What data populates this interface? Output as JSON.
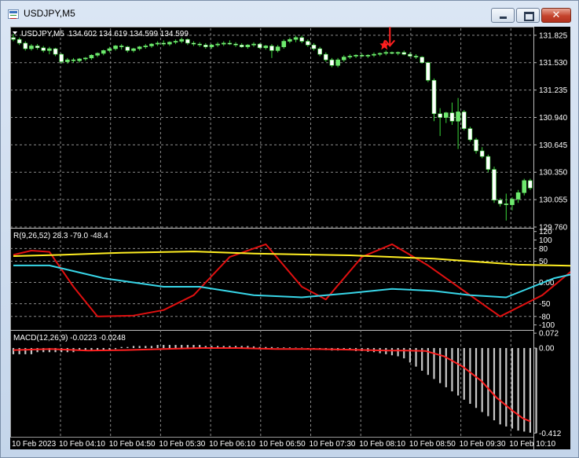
{
  "window": {
    "title": "USDJPY,M5",
    "buttons": {
      "minimize": "minimize",
      "maximize": "maximize",
      "close": "✕"
    }
  },
  "colors": {
    "background": "#000000",
    "grid": "#8a8a8a",
    "text": "#ffffff",
    "candle_up": "#6ee96e",
    "candle_down": "#ffffff",
    "wick": "#39d639",
    "annotation": "#ff1f1f",
    "line_red": "#e01010",
    "line_yellow": "#ffee22",
    "line_cyan": "#38d6e8",
    "histogram": "#c8c8c8",
    "signal_red": "#ff2020"
  },
  "chart_data": [
    {
      "type": "candlestick",
      "symbol_label": "USDJPY,M5",
      "ohlc_label": "134.602 134.619 134.599 134.599",
      "y_ticks": [
        "131.825",
        "131.530",
        "131.235",
        "130.940",
        "130.645",
        "130.350",
        "130.055",
        "129.760"
      ],
      "ylim": [
        129.76,
        131.9
      ],
      "x_ticks": [
        "10 Feb 2023",
        "10 Feb 04:10",
        "10 Feb 04:50",
        "10 Feb 05:30",
        "10 Feb 06:10",
        "10 Feb 06:50",
        "10 Feb 07:30",
        "10 Feb 08:10",
        "10 Feb 08:50",
        "10 Feb 09:30",
        "10 Feb 10:10"
      ],
      "candles": [
        [
          131.8,
          131.84,
          131.76,
          131.78
        ],
        [
          131.78,
          131.8,
          131.72,
          131.74
        ],
        [
          131.74,
          131.76,
          131.66,
          131.68
        ],
        [
          131.68,
          131.73,
          131.66,
          131.71
        ],
        [
          131.71,
          131.73,
          131.67,
          131.69
        ],
        [
          131.69,
          131.71,
          131.64,
          131.66
        ],
        [
          131.66,
          131.7,
          131.62,
          131.68
        ],
        [
          131.68,
          131.69,
          131.6,
          131.62
        ],
        [
          131.62,
          131.63,
          131.52,
          131.54
        ],
        [
          131.54,
          131.58,
          131.52,
          131.56
        ],
        [
          131.56,
          131.58,
          131.53,
          131.55
        ],
        [
          131.55,
          131.58,
          131.53,
          131.57
        ],
        [
          131.57,
          131.59,
          131.55,
          131.58
        ],
        [
          131.58,
          131.62,
          131.56,
          131.61
        ],
        [
          131.61,
          131.64,
          131.59,
          131.63
        ],
        [
          131.63,
          131.67,
          131.61,
          131.66
        ],
        [
          131.66,
          131.7,
          131.64,
          131.68
        ],
        [
          131.68,
          131.72,
          131.66,
          131.71
        ],
        [
          131.71,
          131.73,
          131.67,
          131.7
        ],
        [
          131.7,
          131.71,
          131.64,
          131.66
        ],
        [
          131.66,
          131.69,
          131.64,
          131.68
        ],
        [
          131.68,
          131.71,
          131.66,
          131.7
        ],
        [
          131.7,
          131.73,
          131.68,
          131.71
        ],
        [
          131.71,
          131.74,
          131.69,
          131.73
        ],
        [
          131.73,
          131.76,
          131.71,
          131.74
        ],
        [
          131.74,
          131.77,
          131.71,
          131.73
        ],
        [
          131.73,
          131.76,
          131.71,
          131.75
        ],
        [
          131.75,
          131.78,
          131.73,
          131.76
        ],
        [
          131.76,
          131.8,
          131.74,
          131.78
        ],
        [
          131.78,
          131.79,
          131.72,
          131.74
        ],
        [
          131.74,
          131.76,
          131.71,
          131.73
        ],
        [
          131.73,
          131.75,
          131.7,
          131.72
        ],
        [
          131.72,
          131.74,
          131.68,
          131.7
        ],
        [
          131.7,
          131.73,
          131.68,
          131.72
        ],
        [
          131.72,
          131.75,
          131.7,
          131.73
        ],
        [
          131.73,
          131.76,
          131.71,
          131.74
        ],
        [
          131.74,
          131.77,
          131.72,
          131.73
        ],
        [
          131.73,
          131.75,
          131.7,
          131.72
        ],
        [
          131.72,
          131.74,
          131.69,
          131.7
        ],
        [
          131.7,
          131.73,
          131.68,
          131.72
        ],
        [
          131.72,
          131.75,
          131.7,
          131.73
        ],
        [
          131.73,
          131.74,
          131.68,
          131.69
        ],
        [
          131.69,
          131.72,
          131.67,
          131.71
        ],
        [
          131.71,
          131.73,
          131.58,
          131.66
        ],
        [
          131.66,
          131.72,
          131.64,
          131.7
        ],
        [
          131.7,
          131.78,
          131.68,
          131.76
        ],
        [
          131.76,
          131.8,
          131.74,
          131.78
        ],
        [
          131.78,
          131.82,
          131.75,
          131.8
        ],
        [
          131.8,
          131.82,
          131.74,
          131.76
        ],
        [
          131.76,
          131.78,
          131.7,
          131.72
        ],
        [
          131.72,
          131.74,
          131.66,
          131.68
        ],
        [
          131.68,
          131.7,
          131.6,
          131.62
        ],
        [
          131.62,
          131.64,
          131.54,
          131.56
        ],
        [
          131.56,
          131.58,
          131.48,
          131.5
        ],
        [
          131.5,
          131.58,
          131.48,
          131.56
        ],
        [
          131.56,
          131.61,
          131.54,
          131.59
        ],
        [
          131.59,
          131.62,
          131.57,
          131.6
        ],
        [
          131.6,
          131.62,
          131.58,
          131.61
        ],
        [
          131.61,
          131.63,
          131.59,
          131.6
        ],
        [
          131.6,
          131.62,
          131.58,
          131.61
        ],
        [
          131.61,
          131.64,
          131.59,
          131.62
        ],
        [
          131.62,
          131.64,
          131.6,
          131.63
        ],
        [
          131.63,
          131.66,
          131.61,
          131.64
        ],
        [
          131.64,
          131.65,
          131.62,
          131.63
        ],
        [
          131.63,
          131.65,
          131.61,
          131.64
        ],
        [
          131.64,
          131.66,
          131.61,
          131.62
        ],
        [
          131.62,
          131.64,
          131.59,
          131.6
        ],
        [
          131.6,
          131.62,
          131.57,
          131.59
        ],
        [
          131.59,
          131.6,
          131.52,
          131.53
        ],
        [
          131.53,
          131.54,
          131.32,
          131.34
        ],
        [
          131.34,
          131.36,
          130.9,
          130.98
        ],
        [
          130.98,
          131.04,
          130.74,
          130.94
        ],
        [
          130.94,
          131.0,
          130.88,
          130.99
        ],
        [
          130.99,
          131.1,
          130.86,
          130.9
        ],
        [
          130.9,
          131.15,
          130.6,
          131.0
        ],
        [
          131.0,
          131.02,
          130.8,
          130.82
        ],
        [
          130.82,
          130.84,
          130.68,
          130.7
        ],
        [
          130.7,
          130.72,
          130.55,
          130.58
        ],
        [
          130.58,
          130.62,
          130.5,
          130.52
        ],
        [
          130.52,
          130.54,
          130.35,
          130.38
        ],
        [
          130.38,
          130.41,
          130.02,
          130.05
        ],
        [
          130.05,
          130.07,
          129.98,
          130.01
        ],
        [
          130.01,
          130.12,
          129.83,
          130.0
        ],
        [
          130.0,
          130.08,
          129.94,
          130.06
        ],
        [
          130.06,
          130.16,
          130.02,
          130.13
        ],
        [
          130.13,
          130.28,
          130.1,
          130.26
        ],
        [
          130.26,
          130.28,
          130.16,
          130.18
        ]
      ],
      "annotation": {
        "candle_index": 62,
        "symbol": "red down-arrow with star"
      }
    },
    {
      "type": "line",
      "label": "R(9,26,52) 28.3 -79.0 -48.4",
      "y_ticks": [
        "120",
        "100",
        "80",
        "50",
        "0.00",
        "-50",
        "-80",
        "-100"
      ],
      "ylim": [
        -110,
        125
      ],
      "series": [
        {
          "color": "line_red",
          "values": [
            [
              0,
              65
            ],
            [
              3,
              75
            ],
            [
              6,
              72
            ],
            [
              10,
              -10
            ],
            [
              14,
              -80
            ],
            [
              20,
              -78
            ],
            [
              25,
              -65
            ],
            [
              30,
              -30
            ],
            [
              36,
              60
            ],
            [
              42,
              90
            ],
            [
              48,
              -10
            ],
            [
              52,
              -40
            ],
            [
              58,
              60
            ],
            [
              63,
              90
            ],
            [
              69,
              40
            ],
            [
              75,
              -20
            ],
            [
              81,
              -80
            ],
            [
              88,
              -30
            ],
            [
              94,
              40
            ],
            [
              102,
              -20
            ],
            [
              106,
              -50
            ],
            [
              110,
              -20
            ],
            [
              116,
              40
            ],
            [
              124,
              -70
            ],
            [
              131,
              -20
            ],
            [
              136,
              40
            ],
            [
              144,
              90
            ],
            [
              148,
              -20
            ],
            [
              154,
              -90
            ],
            [
              160,
              -50
            ],
            [
              166,
              60
            ],
            [
              174,
              20
            ],
            [
              180,
              -80
            ],
            [
              186,
              20
            ],
            [
              192,
              60
            ],
            [
              196,
              85
            ],
            [
              202,
              70
            ],
            [
              207,
              0
            ],
            [
              212,
              -60
            ],
            [
              222,
              -30
            ],
            [
              226,
              -60
            ],
            [
              236,
              -100
            ],
            [
              246,
              -75
            ],
            [
              252,
              -100
            ],
            [
              262,
              -95
            ],
            [
              269,
              -60
            ],
            [
              276,
              -40
            ]
          ]
        },
        {
          "color": "line_cyan",
          "values": [
            [
              0,
              40
            ],
            [
              6,
              40
            ],
            [
              15,
              10
            ],
            [
              25,
              -10
            ],
            [
              31,
              -10
            ],
            [
              40,
              -30
            ],
            [
              48,
              -35
            ],
            [
              56,
              -25
            ],
            [
              63,
              -15
            ],
            [
              70,
              -20
            ],
            [
              76,
              -30
            ],
            [
              82,
              -35
            ],
            [
              90,
              10
            ],
            [
              98,
              35
            ],
            [
              108,
              55
            ],
            [
              112,
              65
            ],
            [
              122,
              60
            ],
            [
              132,
              40
            ],
            [
              142,
              20
            ],
            [
              152,
              -10
            ],
            [
              162,
              -20
            ],
            [
              172,
              -30
            ],
            [
              182,
              -35
            ],
            [
              192,
              -60
            ],
            [
              200,
              -65
            ],
            [
              212,
              -70
            ],
            [
              222,
              -70
            ],
            [
              232,
              -70
            ],
            [
              242,
              -75
            ],
            [
              252,
              -90
            ],
            [
              262,
              -90
            ],
            [
              270,
              -98
            ],
            [
              276,
              -100
            ]
          ]
        },
        {
          "color": "line_yellow",
          "values": [
            [
              0,
              62
            ],
            [
              8,
              65
            ],
            [
              18,
              70
            ],
            [
              30,
              73
            ],
            [
              40,
              68
            ],
            [
              56,
              64
            ],
            [
              70,
              56
            ],
            [
              84,
              42
            ],
            [
              98,
              38
            ],
            [
              112,
              33
            ],
            [
              130,
              25
            ],
            [
              140,
              25
            ],
            [
              158,
              48
            ],
            [
              170,
              35
            ],
            [
              182,
              35
            ],
            [
              200,
              25
            ],
            [
              216,
              10
            ],
            [
              230,
              -25
            ],
            [
              242,
              -60
            ],
            [
              256,
              -80
            ],
            [
              268,
              -95
            ],
            [
              276,
              -100
            ]
          ]
        }
      ]
    },
    {
      "type": "bar",
      "label": "MACD(12,26,9) -0.0223 -0.0248",
      "y_ticks": [
        "0.072",
        "0.00",
        "-0.412"
      ],
      "ylim": [
        -0.43,
        0.08
      ],
      "histogram_values": [
        -0.03,
        -0.03,
        -0.03,
        -0.03,
        -0.02,
        -0.02,
        -0.02,
        -0.02,
        -0.02,
        -0.02,
        -0.02,
        -0.01,
        -0.01,
        -0.01,
        -0.01,
        -0.01,
        -0.01,
        -0.005,
        0.005,
        0.005,
        0.01,
        0.01,
        0.01,
        0.01,
        0.015,
        0.015,
        0.015,
        0.015,
        0.015,
        0.015,
        0.015,
        0.015,
        0.01,
        0.01,
        0.01,
        0.01,
        0.01,
        0.01,
        0.01,
        0.01,
        0.008,
        0.005,
        0.005,
        0.005,
        0.003,
        0.003,
        0.003,
        0.002,
        0.002,
        -0.003,
        -0.005,
        -0.008,
        -0.01,
        -0.012,
        -0.012,
        -0.01,
        -0.01,
        -0.015,
        -0.015,
        -0.018,
        -0.02,
        -0.025,
        -0.03,
        -0.035,
        -0.04,
        -0.05,
        -0.07,
        -0.09,
        -0.11,
        -0.13,
        -0.15,
        -0.17,
        -0.19,
        -0.21,
        -0.23,
        -0.25,
        -0.27,
        -0.29,
        -0.31,
        -0.33,
        -0.35,
        -0.37,
        -0.38,
        -0.39,
        -0.4,
        -0.405,
        -0.41,
        -0.412
      ],
      "signal": [
        [
          0,
          -0.01
        ],
        [
          20,
          -0.005
        ],
        [
          40,
          -0.012
        ],
        [
          60,
          -0.01
        ],
        [
          80,
          -0.005
        ],
        [
          100,
          0.0
        ],
        [
          120,
          0.0
        ],
        [
          140,
          -0.005
        ],
        [
          160,
          -0.005
        ],
        [
          180,
          -0.008
        ],
        [
          200,
          -0.012
        ],
        [
          210,
          -0.012
        ],
        [
          220,
          -0.014
        ],
        [
          230,
          -0.04
        ],
        [
          240,
          -0.09
        ],
        [
          250,
          -0.16
        ],
        [
          258,
          -0.24
        ],
        [
          266,
          -0.3
        ],
        [
          272,
          -0.34
        ],
        [
          276,
          -0.355
        ]
      ]
    }
  ]
}
